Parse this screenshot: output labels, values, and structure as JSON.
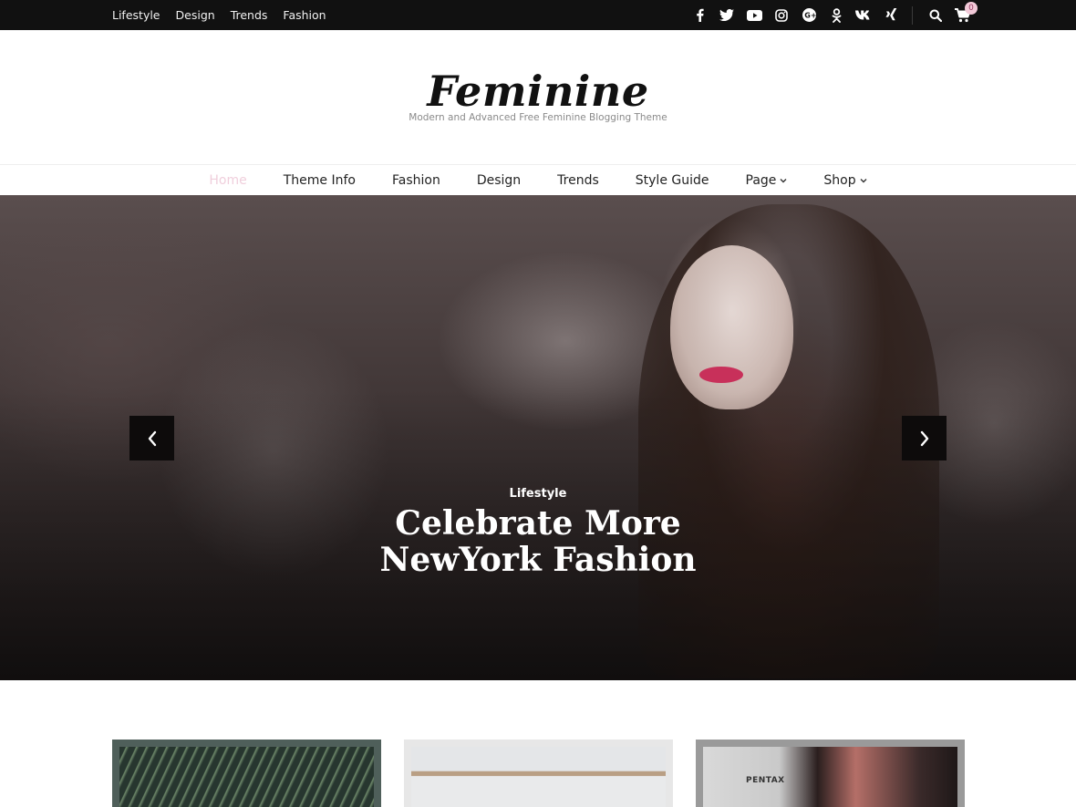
{
  "topbar": {
    "links": [
      "Lifestyle",
      "Design",
      "Trends",
      "Fashion"
    ],
    "social_icons": [
      "facebook-icon",
      "twitter-icon",
      "youtube-icon",
      "instagram-icon",
      "google-plus-icon",
      "odnoklassniki-icon",
      "vk-icon",
      "xing-icon"
    ],
    "cart_count": "0"
  },
  "header": {
    "site_title": "Feminine",
    "tagline": "Modern and Advanced Free Feminine Blogging Theme"
  },
  "nav": {
    "items": [
      {
        "label": "Home",
        "active": true
      },
      {
        "label": "Theme Info"
      },
      {
        "label": "Fashion"
      },
      {
        "label": "Design"
      },
      {
        "label": "Trends"
      },
      {
        "label": "Style Guide"
      },
      {
        "label": "Page",
        "dropdown": true
      },
      {
        "label": "Shop",
        "dropdown": true
      }
    ],
    "active_color": "#f0cfdc",
    "dropdown_glyph": "⌄"
  },
  "slider": {
    "category": "Lifestyle",
    "title": "Celebrate More NewYork Fashion",
    "prev_icon": "chevron-left-icon",
    "next_icon": "chevron-right-icon"
  },
  "cards": [
    {
      "image": "fern-leaves"
    },
    {
      "image": "shelf-decor"
    },
    {
      "image": "woman-with-camera",
      "visible_text": "PENTAX"
    }
  ],
  "colors": {
    "topbar_bg": "#111111",
    "accent_pink": "#f2c9d8",
    "text_dark": "#222222"
  }
}
